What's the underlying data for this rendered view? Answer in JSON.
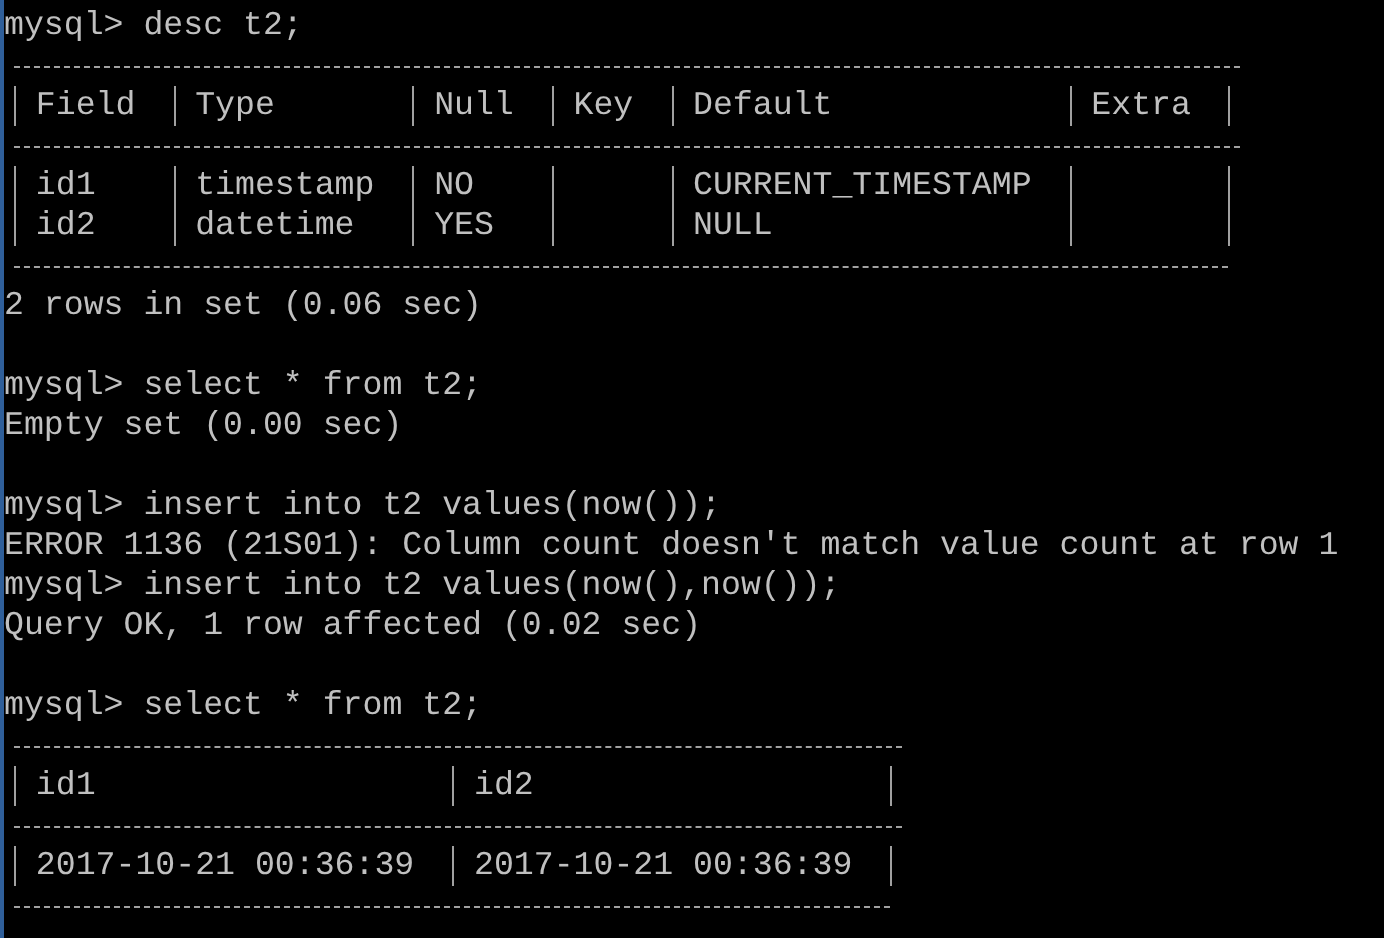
{
  "console": [
    {
      "kind": "prompt",
      "prompt": "mysql>",
      "command": "desc t2;"
    },
    {
      "kind": "table",
      "columns": [
        "Field",
        "Type",
        "Null",
        "Key",
        "Default",
        "Extra"
      ],
      "rows": [
        [
          "id1",
          "timestamp",
          "NO",
          null,
          "CURRENT_TIMESTAMP",
          null
        ],
        [
          "id2",
          "datetime",
          "YES",
          null,
          "NULL",
          null
        ]
      ]
    },
    {
      "kind": "output",
      "text": "2 rows in set (0.06 sec)"
    },
    {
      "kind": "blank"
    },
    {
      "kind": "prompt",
      "prompt": "mysql>",
      "command": "select * from t2;"
    },
    {
      "kind": "output",
      "text": "Empty set (0.00 sec)"
    },
    {
      "kind": "blank"
    },
    {
      "kind": "prompt",
      "prompt": "mysql>",
      "command": "insert into t2 values(now());"
    },
    {
      "kind": "output",
      "text": "ERROR 1136 (21S01): Column count doesn't match value count at row 1"
    },
    {
      "kind": "prompt",
      "prompt": "mysql>",
      "command": "insert into t2 values(now(),now());"
    },
    {
      "kind": "output",
      "text": "Query OK, 1 row affected (0.02 sec)"
    },
    {
      "kind": "blank"
    },
    {
      "kind": "prompt",
      "prompt": "mysql>",
      "command": "select * from t2;"
    },
    {
      "kind": "table",
      "columns": [
        "id1",
        "id2"
      ],
      "rows": [
        [
          "2017-10-21 00:36:39",
          "2017-10-21 00:36:39"
        ]
      ]
    }
  ]
}
